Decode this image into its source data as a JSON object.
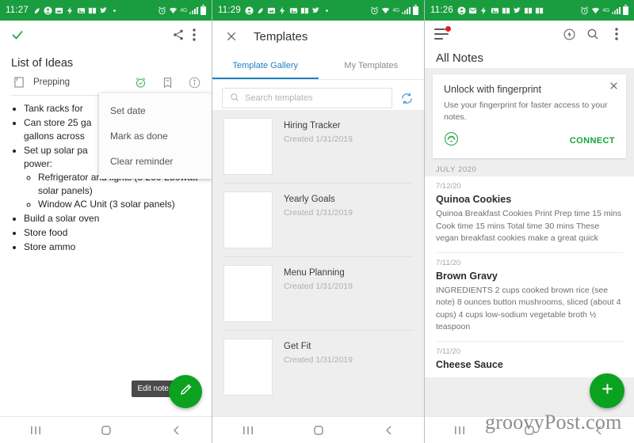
{
  "panel1": {
    "statusbar": {
      "time": "11:27",
      "icons": [
        "leaf-icon",
        "account-icon",
        "photo-icon",
        "flash-icon",
        "image-icon",
        "book-icon",
        "twitter-icon",
        "dot-icon"
      ],
      "right_icons": [
        "alarm-icon",
        "wifi-icon",
        "lte-label",
        "signal-icon",
        "battery-icon"
      ],
      "network_label": "4G"
    },
    "appbar": {
      "check_icon": "check-icon",
      "share_icon": "share-icon",
      "overflow_icon": "overflow-menu-icon"
    },
    "note_title": "List of Ideas",
    "notebook": {
      "icon": "notebook-icon",
      "label": "Prepping"
    },
    "row_icons": [
      "reminder-alarm-icon",
      "tag-icon",
      "info-icon"
    ],
    "bullets": [
      {
        "text": "Tank racks for",
        "children": []
      },
      {
        "text": "Can store 25 ga",
        "text2": "gallons across",
        "children": []
      },
      {
        "text": "Set up solar pa",
        "text2": "power:",
        "children": [
          "Refrigerator and lights (3 200-250watt solar panels)",
          "Window AC Unit (3 solar panels)"
        ]
      },
      {
        "text": "Build a solar oven",
        "children": []
      },
      {
        "text": "Store food",
        "children": []
      },
      {
        "text": "Store ammo",
        "children": []
      }
    ],
    "popup_menu": [
      "Set date",
      "Mark as done",
      "Clear reminder"
    ],
    "tooltip": "Edit note",
    "fab_icon": "edit-pencil-icon",
    "navbar": [
      "recents-icon",
      "home-icon",
      "back-icon"
    ]
  },
  "panel2": {
    "statusbar": {
      "time": "11:29",
      "icons": [
        "account-icon",
        "leaf-icon",
        "photo-icon",
        "flash-icon",
        "image-icon",
        "book-icon",
        "twitter-icon",
        "dot-icon"
      ],
      "right_icons": [
        "alarm-icon",
        "wifi-icon",
        "lte-label",
        "signal-icon",
        "battery-icon"
      ],
      "network_label": "4G"
    },
    "close_icon": "close-icon",
    "title": "Templates",
    "tabs": [
      {
        "label": "Template Gallery",
        "active": true
      },
      {
        "label": "My Templates",
        "active": false
      }
    ],
    "search": {
      "placeholder": "Search templates",
      "icon": "search-icon"
    },
    "refresh_icon": "refresh-icon",
    "templates": [
      {
        "name": "Hiring Tracker",
        "date": "Created 1/31/2019"
      },
      {
        "name": "Yearly Goals",
        "date": "Created 1/31/2019"
      },
      {
        "name": "Menu Planning",
        "date": "Created 1/31/2019"
      },
      {
        "name": "Get Fit",
        "date": "Created 1/31/2019"
      }
    ],
    "navbar": [
      "recents-icon",
      "home-icon",
      "back-icon"
    ]
  },
  "panel3": {
    "statusbar": {
      "time": "11:26",
      "icons": [
        "account-icon",
        "mail-icon",
        "flash-icon",
        "image-icon",
        "book-icon",
        "twitter-icon",
        "book2-icon",
        "book3-icon"
      ],
      "right_icons": [
        "alarm-icon",
        "wifi-icon",
        "lte-label",
        "signal-icon",
        "battery-icon"
      ],
      "network_label": "4G"
    },
    "menu_icon": "hamburger-menu-icon",
    "menu_badge": true,
    "appbar_icons": [
      "work-chat-icon",
      "search-icon",
      "overflow-menu-icon"
    ],
    "title": "All Notes",
    "fingerprint_card": {
      "title": "Unlock with fingerprint",
      "description": "Use your fingerprint for faster access to your notes.",
      "icon": "fingerprint-icon",
      "action": "CONNECT",
      "close_icon": "close-icon"
    },
    "month_header": "JULY 2020",
    "notes": [
      {
        "date": "7/12/20",
        "title": "Quinoa Cookies",
        "snippet": "Quinoa Breakfast Cookies   Print Prep time 15 mins Cook time 15 mins Total time 30 mins   These vegan breakfast cookies make a great quick"
      },
      {
        "date": "7/11/20",
        "title": "Brown Gravy",
        "snippet": "INGREDIENTS 2 cups cooked brown rice (see note) 8 ounces button mushrooms, sliced (about 4 cups) 4 cups low-sodium vegetable broth ½ teaspoon"
      },
      {
        "date": "7/11/20",
        "title": "Cheese Sauce",
        "snippet": ""
      }
    ],
    "fab_icon": "add-plus-icon",
    "navbar": [
      "recents-icon",
      "home-icon",
      "back-icon"
    ]
  },
  "watermark": "groovyPost.com",
  "colors": {
    "status_green": "#1a9d3f",
    "accent_green": "#0aa21f",
    "tab_blue": "#1f7fc4",
    "badge_red": "#e8192c"
  }
}
